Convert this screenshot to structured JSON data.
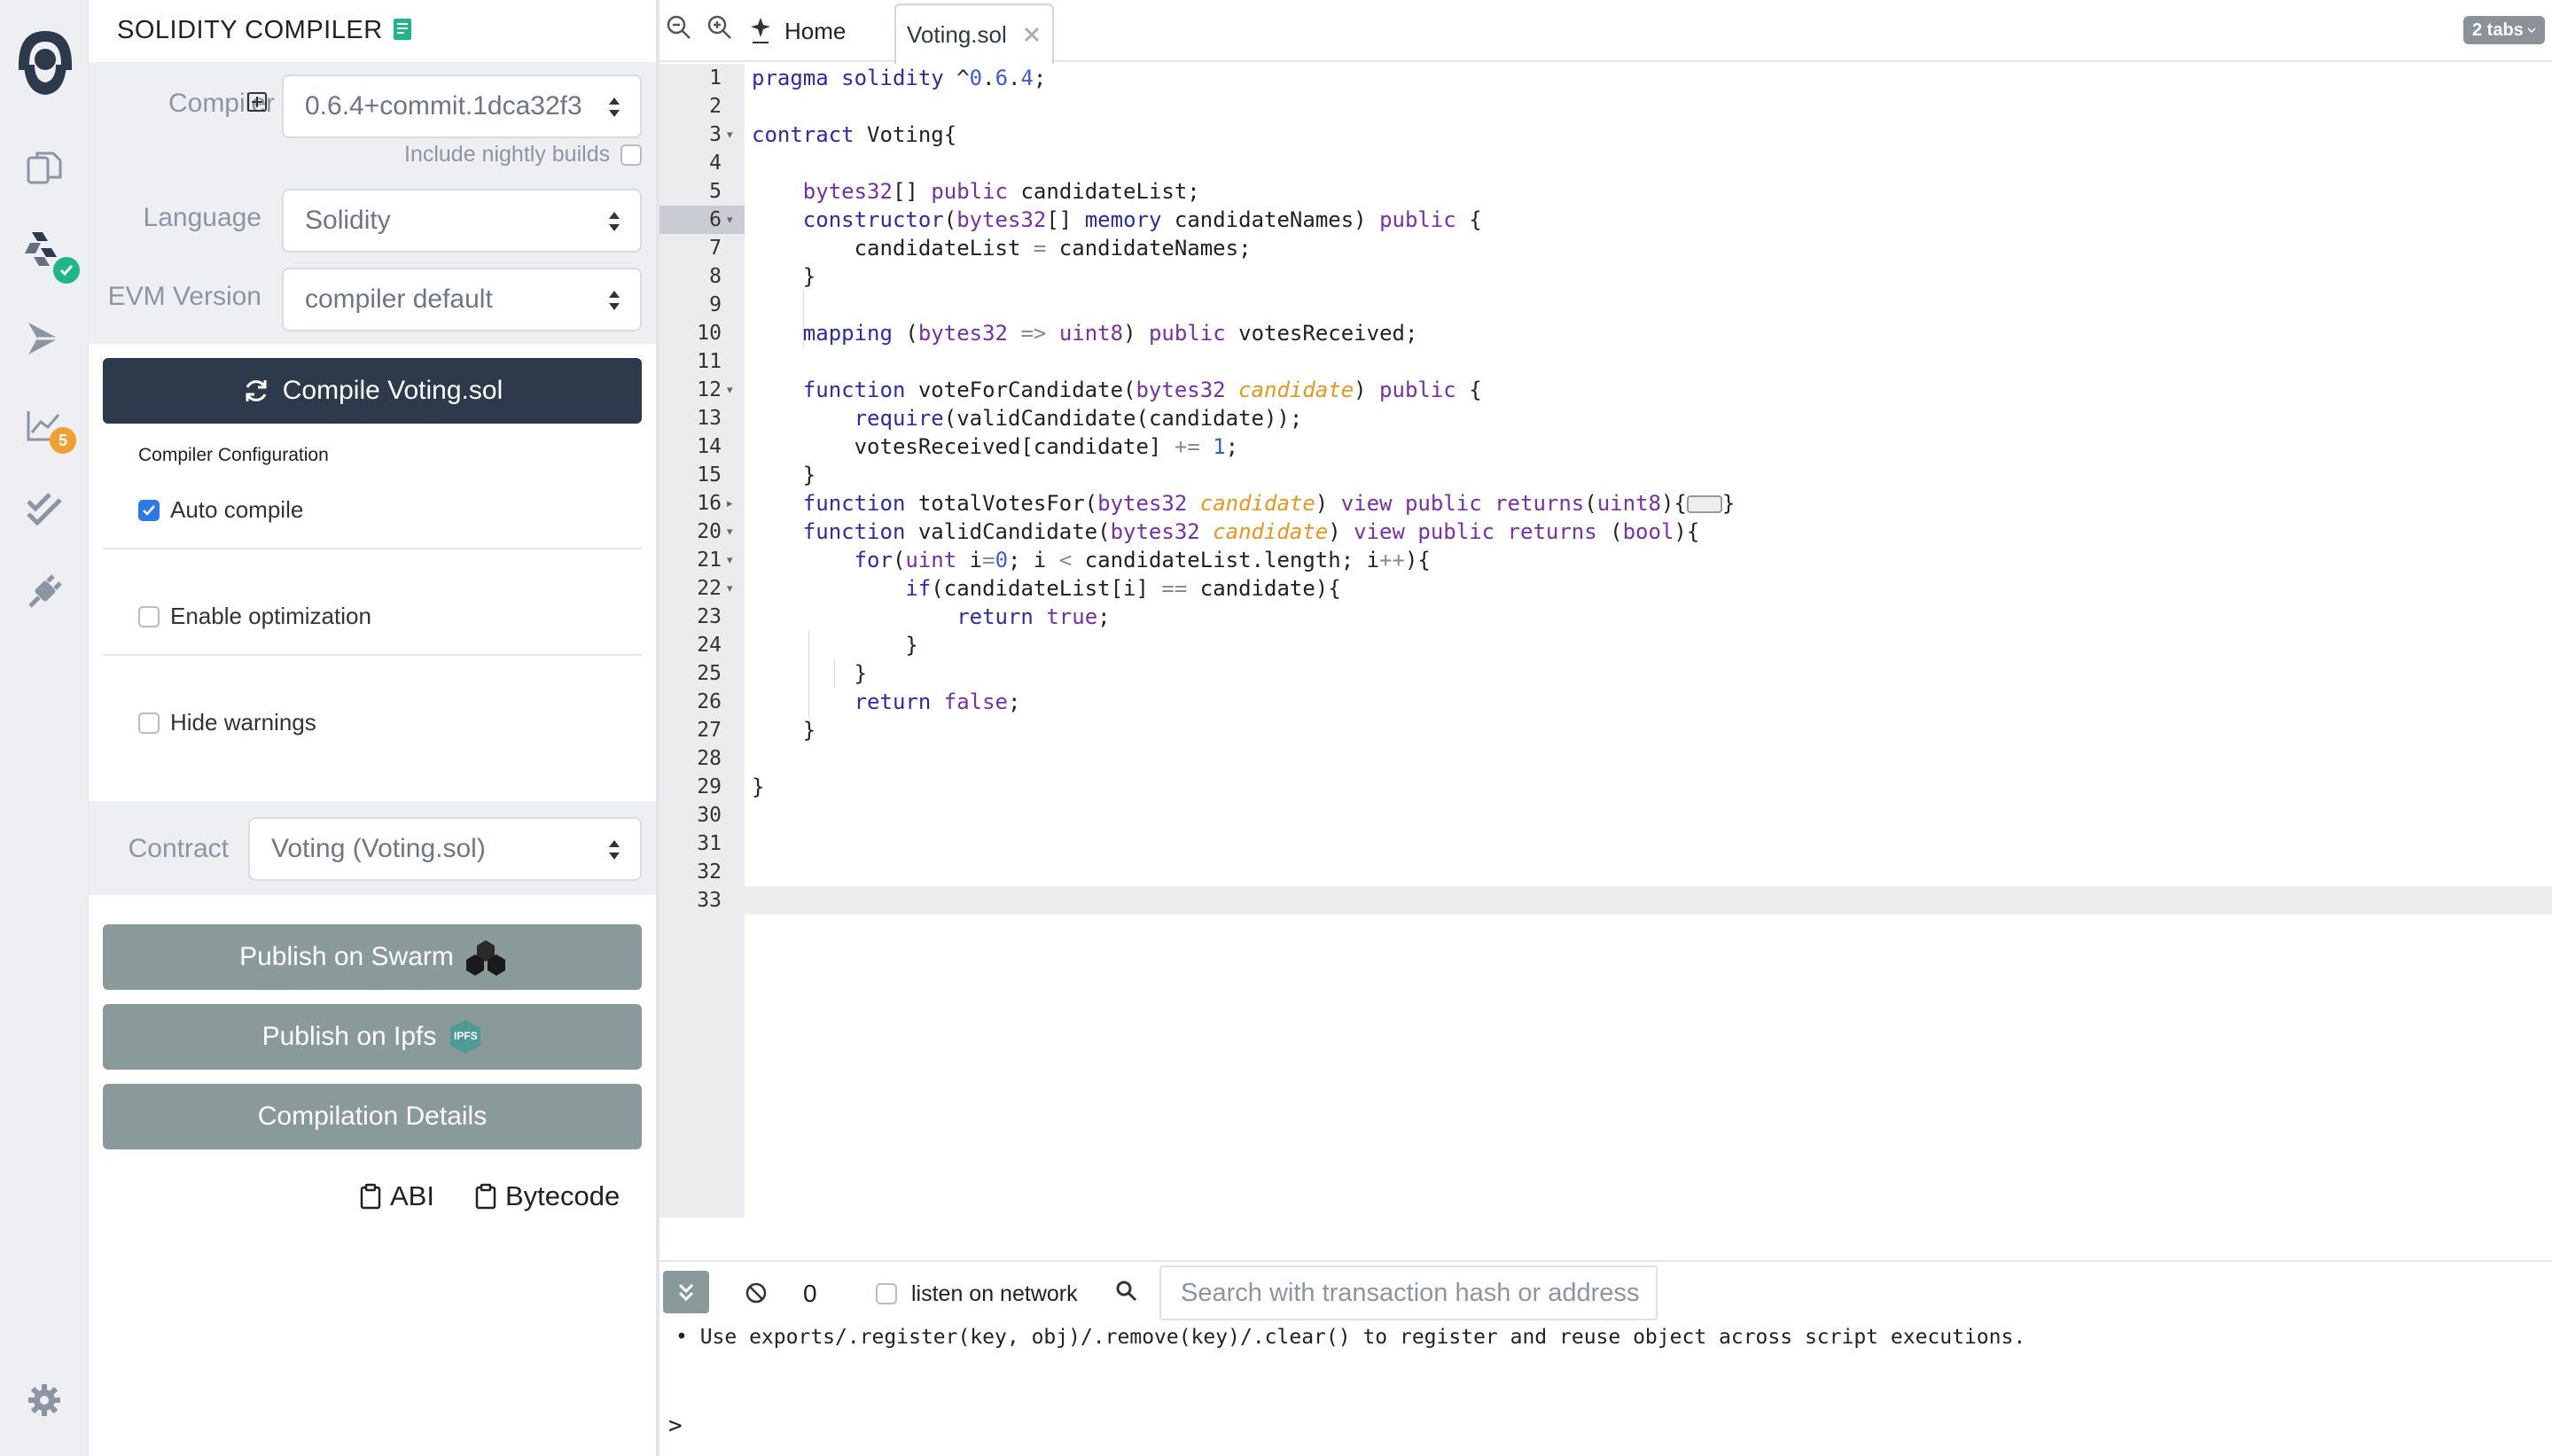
{
  "rail": {
    "items": [
      "remix-logo-icon",
      "file-explorer-icon",
      "solidity-compiler-icon",
      "deploy-run-icon",
      "analysis-icon",
      "testing-icon",
      "plugin-manager-icon"
    ],
    "analysis_badge": "5",
    "settings_icon": "gear-icon"
  },
  "panel": {
    "title": "SOLIDITY COMPILER",
    "compiler_label": "Compiler",
    "compiler_value": "0.6.4+commit.1dca32f3",
    "nightly_label": "Include nightly builds",
    "language_label": "Language",
    "language_value": "Solidity",
    "evm_label": "EVM Version",
    "evm_value": "compiler default",
    "compile_button": "Compile Voting.sol",
    "config_heading": "Compiler Configuration",
    "auto_compile": "Auto compile",
    "enable_optimization": "Enable optimization",
    "hide_warnings": "Hide warnings",
    "contract_label": "Contract",
    "contract_value": "Voting (Voting.sol)",
    "publish_swarm": "Publish on Swarm",
    "publish_ipfs": "Publish on Ipfs",
    "ipfs_badge": "IPFS",
    "compilation_details": "Compilation Details",
    "abi": "ABI",
    "bytecode": "Bytecode"
  },
  "tabs": {
    "home": "Home",
    "active_file": "Voting.sol",
    "count": "2 tabs"
  },
  "editor": {
    "line_numbers": [
      "1",
      "2",
      "3",
      "4",
      "5",
      "6",
      "7",
      "8",
      "9",
      "10",
      "11",
      "12",
      "13",
      "14",
      "15",
      "16",
      "20",
      "21",
      "22",
      "23",
      "24",
      "25",
      "26",
      "27",
      "28",
      "29",
      "30",
      "31",
      "32",
      "33"
    ],
    "lines": [
      "pragma solidity ^0.6.4;",
      "",
      "contract Voting{",
      "",
      "    bytes32[] public candidateList;",
      "    constructor(bytes32[] memory candidateNames) public {",
      "        candidateList = candidateNames;",
      "    }",
      "",
      "    mapping (bytes32 => uint8) public votesReceived;",
      "",
      "    function voteForCandidate(bytes32 candidate) public {",
      "        require(validCandidate(candidate));",
      "        votesReceived[candidate] += 1;",
      "    }",
      "    function totalVotesFor(bytes32 candidate) view public returns(uint8){…}",
      "    function validCandidate(bytes32 candidate) view public returns (bool){",
      "        for(uint i=0; i < candidateList.length; i++){",
      "            if(candidateList[i] == candidate){",
      "                return true;",
      "            }",
      "        }",
      "        return false;",
      "    }",
      "",
      "}",
      "",
      "",
      "",
      ""
    ]
  },
  "terminal": {
    "count": "0",
    "listen_label": "listen on network",
    "search_placeholder": "Search with transaction hash or address",
    "log_line": "• Use exports/.register(key, obj)/.remove(key)/.clear() to register and reuse object across script executions.",
    "prompt": ">"
  },
  "colors": {
    "compile_button": "#2c3a4b",
    "secondary_button": "#8a9a9b",
    "checkbox_checked": "#2c7be5",
    "badge_orange": "#f0a030",
    "badge_green": "#1fb68a",
    "panel_gray": "#eeeff2"
  }
}
